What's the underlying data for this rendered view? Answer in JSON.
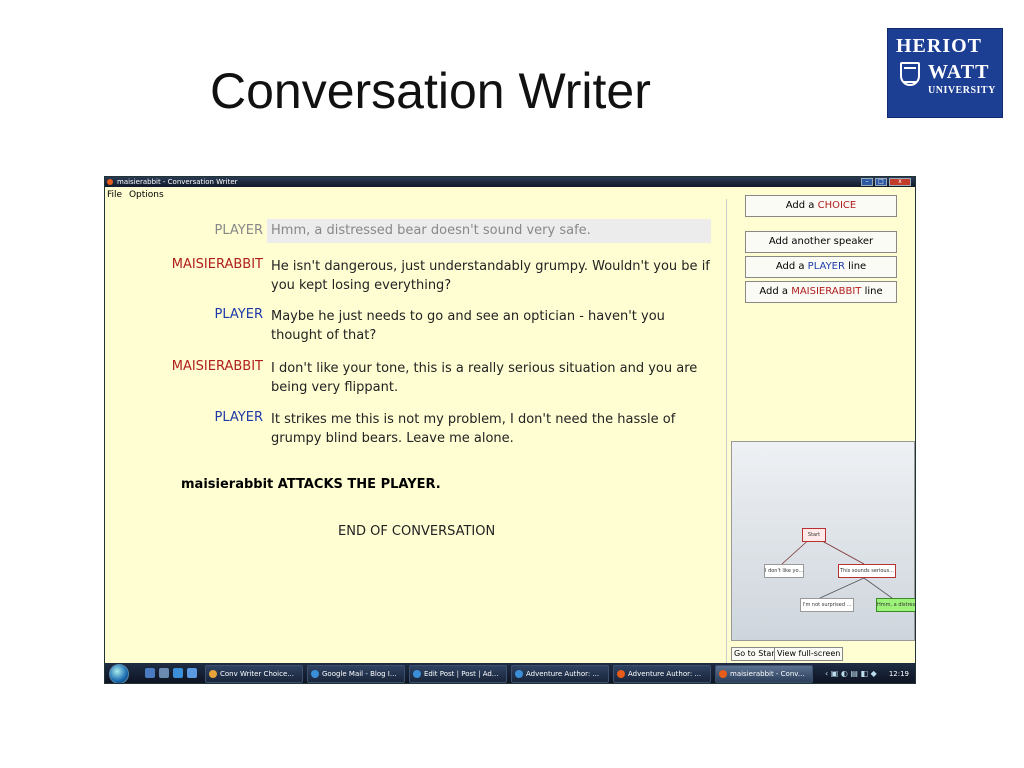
{
  "slide": {
    "title": "Conversation Writer",
    "logo": {
      "line1": "HERIOT",
      "line2": "WATT",
      "line3": "UNIVERSITY"
    }
  },
  "window": {
    "title": "maisierabbit - Conversation Writer",
    "menu": [
      "File",
      "Options"
    ]
  },
  "conversation": {
    "lines": [
      {
        "speaker": "PLAYER",
        "text": "Hmm, a distressed bear doesn't sound very safe."
      },
      {
        "speaker": "MAISIERABBIT",
        "text": "He isn't dangerous, just understandably grumpy. Wouldn't you be if you kept losing everything?"
      },
      {
        "speaker": "PLAYER",
        "text": "Maybe he just needs to go and see an optician - haven't you thought of that?"
      },
      {
        "speaker": "MAISIERABBIT",
        "text": "I don't like your tone, this is a really serious situation and you are being very flippant."
      },
      {
        "speaker": "PLAYER",
        "text": "It strikes me this is not my problem, I don't need the hassle of grumpy blind bears. Leave me alone."
      }
    ],
    "action": "maisierabbit ATTACKS THE PLAYER.",
    "end_text": "END OF CONVERSATION"
  },
  "buttons": {
    "add_choice_prefix": "Add a ",
    "add_choice_word": "CHOICE",
    "add_speaker": "Add another speaker",
    "add_player_prefix": "Add a ",
    "add_player_word": "PLAYER",
    "add_player_suffix": " line",
    "add_mais_prefix": "Add a ",
    "add_mais_word": "MAISIERABBIT",
    "add_mais_suffix": " line",
    "go_to_start": "Go to Start",
    "view_full_screen": "View full-screen"
  },
  "minimap": {
    "nodes": [
      "Start",
      "I don't like yo...",
      "This sounds serious...",
      "I'm not surprised ...",
      "Hmm, a distress"
    ]
  },
  "taskbar": {
    "tasks": [
      "Conv Writer Choice...",
      "Google Mail - Blog I...",
      "Edit Post | Post | Ad...",
      "Adventure Author: ...",
      "Adventure Author: ...",
      "maisierabbit - Conv..."
    ],
    "clock": "12:19"
  },
  "colors": {
    "player": "#1e3aa8",
    "maisierabbit": "#b01e1e",
    "window_bg": "#fffed3",
    "logo_bg": "#1d3f93"
  }
}
